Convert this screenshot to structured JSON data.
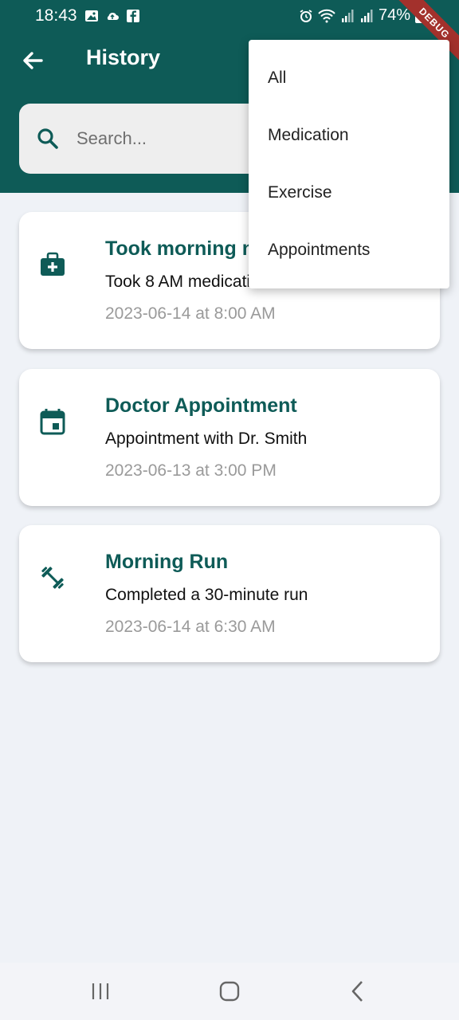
{
  "status_bar": {
    "time": "18:43",
    "battery": "74%"
  },
  "debug_label": "DEBUG",
  "app_bar": {
    "title": "History"
  },
  "search": {
    "placeholder": "Search..."
  },
  "history_items": [
    {
      "title": "Took morning medication",
      "description": "Took 8 AM medication",
      "date": "2023-06-14 at 8:00 AM",
      "icon": "medical-bag-icon"
    },
    {
      "title": "Doctor Appointment",
      "description": "Appointment with Dr. Smith",
      "date": "2023-06-13 at 3:00 PM",
      "icon": "calendar-icon"
    },
    {
      "title": "Morning Run",
      "description": "Completed a 30-minute run",
      "date": "2023-06-14 at 6:30 AM",
      "icon": "dumbbell-icon"
    }
  ],
  "filter_menu": {
    "items": [
      "All",
      "Medication",
      "Exercise",
      "Appointments"
    ]
  },
  "colors": {
    "primary": "#0e5b57",
    "background": "#eff2f7",
    "muted": "#9a9a9a"
  }
}
